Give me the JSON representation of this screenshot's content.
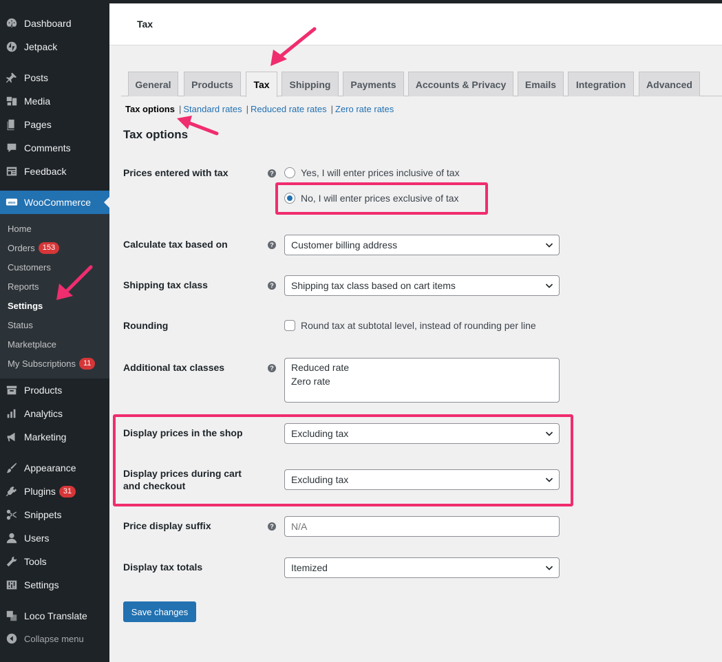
{
  "sidebar": {
    "items": [
      {
        "label": "Dashboard",
        "icon": "dashboard-icon"
      },
      {
        "label": "Jetpack",
        "icon": "jetpack-icon"
      },
      {
        "label": "Posts",
        "icon": "pin-icon"
      },
      {
        "label": "Media",
        "icon": "media-icon"
      },
      {
        "label": "Pages",
        "icon": "pages-icon"
      },
      {
        "label": "Comments",
        "icon": "comments-icon"
      },
      {
        "label": "Feedback",
        "icon": "feedback-icon"
      },
      {
        "label": "WooCommerce",
        "icon": "woocommerce-icon"
      },
      {
        "label": "Products",
        "icon": "archive-icon"
      },
      {
        "label": "Analytics",
        "icon": "analytics-icon"
      },
      {
        "label": "Marketing",
        "icon": "megaphone-icon"
      },
      {
        "label": "Appearance",
        "icon": "brush-icon"
      },
      {
        "label": "Plugins",
        "icon": "plug-icon"
      },
      {
        "label": "Snippets",
        "icon": "scissors-icon"
      },
      {
        "label": "Users",
        "icon": "user-icon"
      },
      {
        "label": "Tools",
        "icon": "wrench-icon"
      },
      {
        "label": "Settings",
        "icon": "sliders-icon"
      },
      {
        "label": "Loco Translate",
        "icon": "translate-icon"
      }
    ],
    "plugins_badge": "31",
    "woo_submenu": [
      {
        "label": "Home"
      },
      {
        "label": "Orders",
        "badge": "153"
      },
      {
        "label": "Customers"
      },
      {
        "label": "Reports"
      },
      {
        "label": "Settings"
      },
      {
        "label": "Status"
      },
      {
        "label": "Marketplace"
      },
      {
        "label": "My Subscriptions",
        "badge": "11"
      }
    ],
    "collapse_label": "Collapse menu"
  },
  "header": {
    "title": "Tax"
  },
  "tabs": [
    "General",
    "Products",
    "Tax",
    "Shipping",
    "Payments",
    "Accounts & Privacy",
    "Emails",
    "Integration",
    "Advanced"
  ],
  "active_tab": "Tax",
  "subsub": {
    "current": "Tax options",
    "links": [
      "Standard rates",
      "Reduced rate rates",
      "Zero rate rates"
    ]
  },
  "section_title": "Tax options",
  "fields": {
    "prices_entered": {
      "label": "Prices entered with tax",
      "options": [
        "Yes, I will enter prices inclusive of tax",
        "No, I will enter prices exclusive of tax"
      ],
      "selected": "No, I will enter prices exclusive of tax"
    },
    "calculate_based_on": {
      "label": "Calculate tax based on",
      "value": "Customer billing address"
    },
    "shipping_tax_class": {
      "label": "Shipping tax class",
      "value": "Shipping tax class based on cart items"
    },
    "rounding": {
      "label": "Rounding",
      "checkbox_label": "Round tax at subtotal level, instead of rounding per line",
      "checked": false
    },
    "additional_classes": {
      "label": "Additional tax classes",
      "value": "Reduced rate\nZero rate"
    },
    "display_shop": {
      "label": "Display prices in the shop",
      "value": "Excluding tax"
    },
    "display_cart": {
      "label": "Display prices during cart and checkout",
      "value": "Excluding tax"
    },
    "price_suffix": {
      "label": "Price display suffix",
      "placeholder": "N/A"
    },
    "display_totals": {
      "label": "Display tax totals",
      "value": "Itemized"
    }
  },
  "save_label": "Save changes",
  "colors": {
    "accent": "#2271b1",
    "highlight": "#f02d6e",
    "sidebar_bg": "#1d2327"
  }
}
